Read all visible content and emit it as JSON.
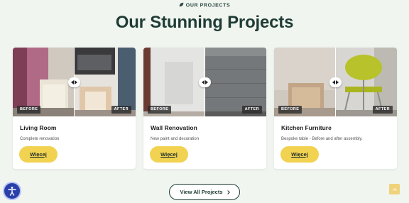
{
  "section": {
    "eyebrow": "OUR PROJECTS",
    "title": "Our Stunning Projects"
  },
  "projects": [
    {
      "title": "Living Room",
      "description": "Complete renovation",
      "before_label": "BEFORE",
      "after_label": "AFTER",
      "button_label": "Więcej"
    },
    {
      "title": "Wall Renovation",
      "description": "New paint and decoration",
      "before_label": "BEFORE",
      "after_label": "AFTER",
      "button_label": "Więcej"
    },
    {
      "title": "Kitchen Furniture",
      "description": "Bespoke table - Before and after assembly.",
      "before_label": "BEFORE",
      "after_label": "AFTER",
      "button_label": "Więcej"
    }
  ],
  "view_all_label": "View All Projects",
  "colors": {
    "background": "#f1f5f0",
    "heading": "#1e3c35",
    "button": "#f1d251",
    "accessibility": "#2a3fa8"
  },
  "icons": [
    "leaf-icon",
    "compare-arrows-icon",
    "chevron-right-icon",
    "accessibility-icon",
    "arrow-up-icon"
  ]
}
